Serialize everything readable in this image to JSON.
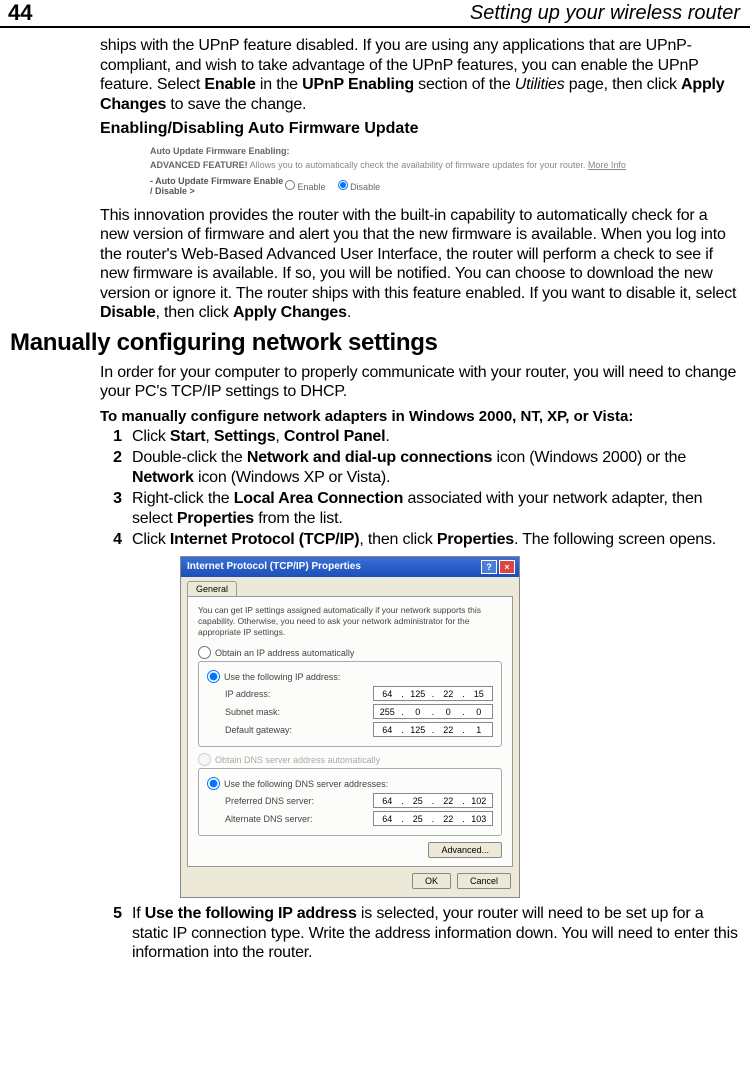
{
  "page": {
    "number": "44",
    "title": "Setting up your wireless router"
  },
  "para1": {
    "t1": "ships with the UPnP feature disabled. If you are using any applications that are UPnP-compliant, and wish to take advantage of the UPnP features, you can enable the UPnP feature. Select ",
    "b1": "Enable",
    "t2": " in the ",
    "b2": "UPnP Enabling",
    "t3": " section of the ",
    "i1": "Utilities",
    "t4": " page, then click ",
    "b3": "Apply Changes",
    "t5": " to save the change."
  },
  "subhead1": "Enabling/Disabling Auto Firmware Update",
  "screenshot1": {
    "title": "Auto Update Firmware Enabling:",
    "adv": "ADVANCED FEATURE!",
    "desc": " Allows you to automatically check the availability of firmware updates for your router. ",
    "more": "More Info",
    "label_pre": "- ",
    "label": "Auto Update Firmware Enable / Disable >",
    "opt1": "Enable",
    "opt2": "Disable"
  },
  "para2": {
    "t1": "This innovation provides the router with the built-in capability to automatically check for a new version of firmware and alert you that the new firmware is available. When you log into the router's Web-Based Advanced User Interface, the router will perform a check to see if new firmware is available. If so, you will be notified. You can choose to download the new version or ignore it. The router ships with this feature enabled. If you want to disable it, select ",
    "b1": "Disable",
    "t2": ", then click ",
    "b2": "Apply Changes",
    "t3": "."
  },
  "h1": "Manually configuring network settings",
  "para3": "In order for your computer to properly communicate with your router, you will need to change your PC's TCP/IP settings to DHCP.",
  "listhead": "To manually configure network adapters in Windows 2000, NT, XP, or Vista:",
  "step1": {
    "n": "1",
    "t1": "Click ",
    "b1": "Start",
    "t2": ", ",
    "b2": "Settings",
    "t3": ", ",
    "b3": "Control Panel",
    "t4": "."
  },
  "step2": {
    "n": "2",
    "t1": "Double-click the ",
    "b1": "Network and dial-up connections",
    "t2": " icon (Windows 2000) or the ",
    "b2": "Network",
    "t3": " icon (Windows XP or Vista)."
  },
  "step3": {
    "n": "3",
    "t1": "Right-click the ",
    "b1": "Local Area Connection",
    "t2": " associated with your network adapter, then select ",
    "b2": "Properties",
    "t3": " from the list."
  },
  "step4": {
    "n": "4",
    "t1": "Click ",
    "b1": "Internet Protocol (TCP/IP)",
    "t2": ", then click ",
    "b2": "Properties",
    "t3": ". The following screen opens."
  },
  "dialog": {
    "title": "Internet Protocol (TCP/IP) Properties",
    "tab": "General",
    "desc": "You can get IP settings assigned automatically if your network supports this capability. Otherwise, you need to ask your network administrator for the appropriate IP settings.",
    "r1": "Obtain an IP address automatically",
    "r2": "Use the following IP address:",
    "ip_label": "IP address:",
    "ip": [
      "64",
      "125",
      "22",
      "15"
    ],
    "mask_label": "Subnet mask:",
    "mask": [
      "255",
      "0",
      "0",
      "0"
    ],
    "gw_label": "Default gateway:",
    "gw": [
      "64",
      "125",
      "22",
      "1"
    ],
    "r3": "Obtain DNS server address automatically",
    "r4": "Use the following DNS server addresses:",
    "pdns_label": "Preferred DNS server:",
    "pdns": [
      "64",
      "25",
      "22",
      "102"
    ],
    "adns_label": "Alternate DNS server:",
    "adns": [
      "64",
      "25",
      "22",
      "103"
    ],
    "advanced": "Advanced...",
    "ok": "OK",
    "cancel": "Cancel"
  },
  "step5": {
    "n": "5",
    "t1": "If ",
    "b1": "Use the following IP address",
    "t2": " is selected, your router will need to be set up for a static IP connection type. Write the address information down. You will need to enter this information into the router."
  }
}
